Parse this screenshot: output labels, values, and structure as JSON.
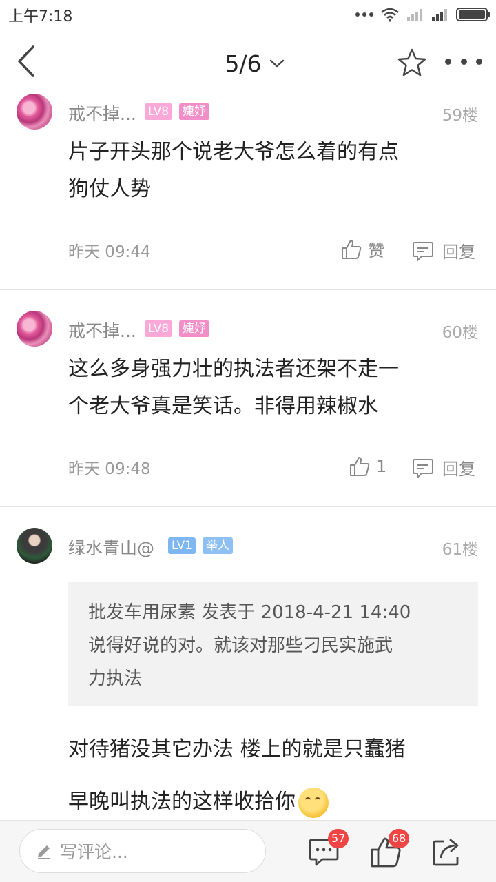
{
  "status_bar": {
    "time": "上午7:18"
  },
  "header": {
    "page_indicator": "5/6"
  },
  "posts": [
    {
      "username": "戒不掉...",
      "level": "LV8",
      "title": "婕妤",
      "floor": "59楼",
      "content_lines": [
        "片子开头那个说老大爷怎么着的有点",
        "狗仗人势"
      ],
      "time": "昨天 09:44",
      "like_label": "赞",
      "reply_label": "回复"
    },
    {
      "username": "戒不掉...",
      "level": "LV8",
      "title": "婕妤",
      "floor": "60楼",
      "content_lines": [
        "这么多身强力壮的执法者还架不走一",
        "个老大爷真是笑话。非得用辣椒水"
      ],
      "time": "昨天 09:48",
      "like_label": "1",
      "reply_label": "回复"
    },
    {
      "username": "绿水青山@",
      "level": "LV1",
      "title": "举人",
      "floor": "61楼",
      "quote_lines": [
        "批发车用尿素 发表于 2018-4-21 14:40",
        "说得好说的对。就该对那些刁民实施武",
        "力执法"
      ],
      "content_lines": [
        "对待猪没其它办法 楼上的就是只蠢猪",
        "早晚叫执法的这样收拾你"
      ],
      "emoji": "thinking-emoji"
    }
  ],
  "bottom_bar": {
    "comment_placeholder": "写评论...",
    "comment_count": "57",
    "like_count": "68"
  },
  "colors": {
    "badge_pink": "#f9a8d8",
    "badge_blue": "#7eb7f2",
    "count_badge": "#ef4545"
  }
}
